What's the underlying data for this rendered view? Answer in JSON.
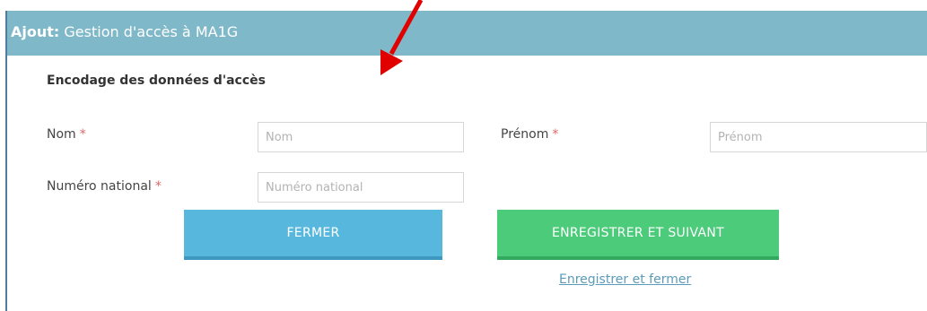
{
  "header": {
    "bold": "Ajout:",
    "title": "Gestion d'accès à MA1G"
  },
  "form": {
    "section_title": "Encodage des données d'accès",
    "required_mark": "*",
    "fields": [
      {
        "label": "Nom",
        "placeholder": "Nom"
      },
      {
        "label": "Prénom",
        "placeholder": "Prénom"
      },
      {
        "label": "Numéro national",
        "placeholder": "Numéro national"
      }
    ]
  },
  "buttons": {
    "close": "FERMER",
    "save_next": "ENREGISTRER ET SUIVANT",
    "save_close_link": "Enregistrer et fermer"
  },
  "colors": {
    "header": "#7fb8c8",
    "close_button": "#58b7dd",
    "save_button": "#4ccb7a",
    "required": "#e06666",
    "annotation_arrow": "#e00000"
  }
}
